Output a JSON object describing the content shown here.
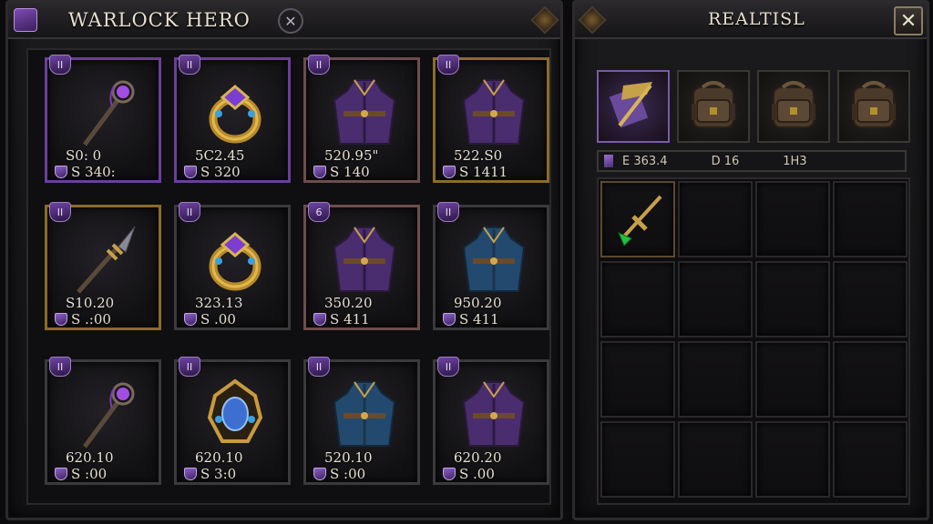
{
  "left_panel": {
    "title": "WARLOCK HERO",
    "cross_icon": "crossed-swords-icon",
    "items": [
      {
        "rank": "II",
        "value": "S0: 0",
        "cost": "S 340:",
        "rarity": "epic",
        "icon": "staff-icon"
      },
      {
        "rank": "II",
        "value": "5C2.45",
        "cost": "S 320",
        "rarity": "epic",
        "icon": "ring-icon"
      },
      {
        "rank": "II",
        "value": "520.95\"",
        "cost": "S 140",
        "rarity": "rare",
        "icon": "robe-icon"
      },
      {
        "rank": "II",
        "value": "522.S0",
        "cost": "S 1411",
        "rarity": "legendary",
        "icon": "robe-icon"
      },
      {
        "rank": "II",
        "value": "S10.20",
        "cost": "S .:00",
        "rarity": "legendary",
        "icon": "spear-icon"
      },
      {
        "rank": "II",
        "value": "323.13",
        "cost": "S .00",
        "rarity": "common",
        "icon": "ring-icon"
      },
      {
        "rank": "6",
        "value": "350.20",
        "cost": "S 411",
        "rarity": "rare",
        "icon": "robe-icon"
      },
      {
        "rank": "II",
        "value": "950.20",
        "cost": "S 411",
        "rarity": "common",
        "icon": "robe-blue-icon"
      },
      {
        "rank": "II",
        "value": "620.10",
        "cost": "S :00",
        "rarity": "common",
        "icon": "staff-icon"
      },
      {
        "rank": "II",
        "value": "620.10",
        "cost": "S 3:0",
        "rarity": "common",
        "icon": "amulet-icon"
      },
      {
        "rank": "II",
        "value": "520.10",
        "cost": "S :00",
        "rarity": "common",
        "icon": "robe-blue-icon"
      },
      {
        "rank": "II",
        "value": "620.20",
        "cost": "S .00",
        "rarity": "common",
        "icon": "robe-icon"
      }
    ]
  },
  "right_panel": {
    "title": "REALTISL",
    "close_label": "✕",
    "bag_tabs": [
      {
        "icon": "scroll-icon",
        "active": true
      },
      {
        "icon": "backpack-icon",
        "active": false
      },
      {
        "icon": "backpack-icon",
        "active": false
      },
      {
        "icon": "backpack-icon",
        "active": false
      }
    ],
    "stats": {
      "stat_1": "E 363.4",
      "stat_2": "D 16",
      "stat_3": "1H3"
    },
    "inventory": {
      "filled_slot_icon": "green-dagger-icon"
    }
  }
}
